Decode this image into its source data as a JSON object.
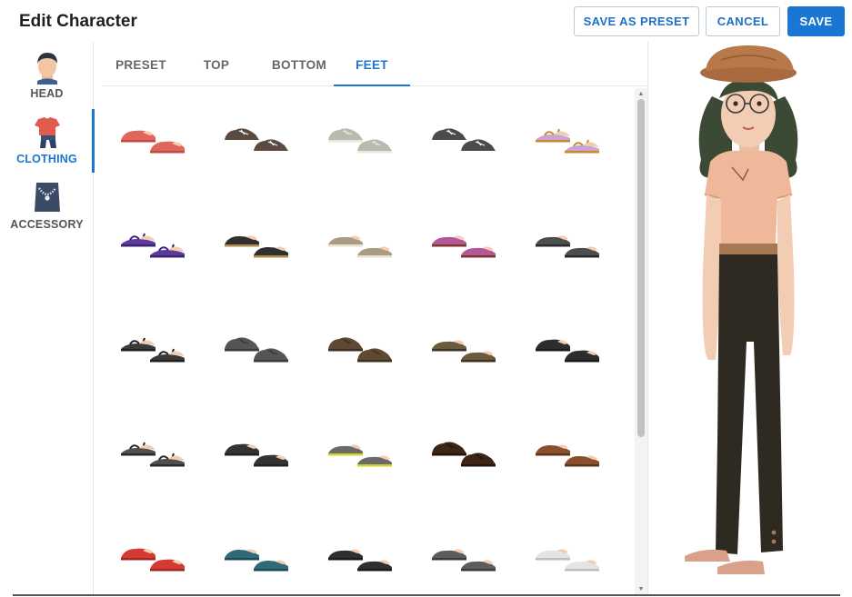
{
  "header": {
    "title": "Edit Character",
    "save_as_preset_label": "SAVE AS PRESET",
    "cancel_label": "CANCEL",
    "save_label": "SAVE"
  },
  "sidebar": {
    "items": [
      {
        "label": "HEAD",
        "icon": "head-icon",
        "active": false
      },
      {
        "label": "CLOTHING",
        "icon": "shirt-icon",
        "active": true
      },
      {
        "label": "ACCESSORY",
        "icon": "necklace-icon",
        "active": false
      }
    ]
  },
  "tabs": [
    {
      "label": "PRESET",
      "active": false
    },
    {
      "label": "TOP",
      "active": false
    },
    {
      "label": "BOTTOM",
      "active": false
    },
    {
      "label": "FEET",
      "active": true
    }
  ],
  "shoes": [
    {
      "name": "coral-flat",
      "style": "flat",
      "color": "#e0655a",
      "accent": "#c24a41"
    },
    {
      "name": "brown-sneaker",
      "style": "sneaker",
      "color": "#5a4a40",
      "accent": "#ffffff"
    },
    {
      "name": "gray-sneaker",
      "style": "sneaker",
      "color": "#b9b9ad",
      "accent": "#e8e8e0"
    },
    {
      "name": "charcoal-sneaker",
      "style": "sneaker",
      "color": "#4b4b4b",
      "accent": "#ffffff"
    },
    {
      "name": "pink-sandal",
      "style": "sandal",
      "color": "#c8a3d4",
      "accent": "#c98a2a"
    },
    {
      "name": "purple-sandal",
      "style": "sandal",
      "color": "#5b3a9e",
      "accent": "#3c2470"
    },
    {
      "name": "black-loafer",
      "style": "loafer",
      "color": "#2f2f2f",
      "accent": "#b08a4a"
    },
    {
      "name": "beige-slipper",
      "style": "slipper",
      "color": "#a89c86",
      "accent": "#e9e0cf"
    },
    {
      "name": "magenta-slipper",
      "style": "slipper",
      "color": "#b5559a",
      "accent": "#7a3a2a"
    },
    {
      "name": "dark-slipon",
      "style": "slipper",
      "color": "#4a4f4d",
      "accent": "#2a2a2a"
    },
    {
      "name": "black-strap-sandal",
      "style": "sandal",
      "color": "#3a3a3a",
      "accent": "#1f1f1f"
    },
    {
      "name": "charcoal-oxford",
      "style": "oxford",
      "color": "#555555",
      "accent": "#3a3a3a"
    },
    {
      "name": "brown-oxford",
      "style": "oxford",
      "color": "#5e4a32",
      "accent": "#3e2f1e"
    },
    {
      "name": "olive-slipper",
      "style": "slipper",
      "color": "#6b5a3c",
      "accent": "#3e3322"
    },
    {
      "name": "black-mary-jane",
      "style": "flat",
      "color": "#2d2d2d",
      "accent": "#1a1a1a"
    },
    {
      "name": "thong-sandal",
      "style": "sandal",
      "color": "#4f4f4f",
      "accent": "#2a2a2a"
    },
    {
      "name": "black-boot",
      "style": "flat",
      "color": "#333333",
      "accent": "#222222"
    },
    {
      "name": "yellow-stripe-slipon",
      "style": "slipper",
      "color": "#6a6a6a",
      "accent": "#d6d02a"
    },
    {
      "name": "dark-brown-oxford",
      "style": "oxford",
      "color": "#3c2416",
      "accent": "#241409"
    },
    {
      "name": "tan-loafer",
      "style": "loafer",
      "color": "#8a4f2c",
      "accent": "#5e3318"
    },
    {
      "name": "red-moccasin",
      "style": "flat",
      "color": "#d33a34",
      "accent": "#a32420"
    },
    {
      "name": "teal-loafer",
      "style": "loafer",
      "color": "#2e6a78",
      "accent": "#1d4a55"
    },
    {
      "name": "black-slipon",
      "style": "slipper",
      "color": "#2f2f2f",
      "accent": "#1b1b1b"
    },
    {
      "name": "gray-slipon",
      "style": "slipper",
      "color": "#5c5c5c",
      "accent": "#3b3b3b"
    },
    {
      "name": "white-slipon",
      "style": "slipper",
      "color": "#e4e4e4",
      "accent": "#bdbdbd"
    }
  ],
  "colors": {
    "accent": "#1976d2",
    "skin": "#f2cdb4",
    "hat": "#b8784a",
    "hair": "#3a4a34",
    "shirt": "#f0b89a",
    "pants": "#2e2a22",
    "belt": "#a57a52"
  }
}
